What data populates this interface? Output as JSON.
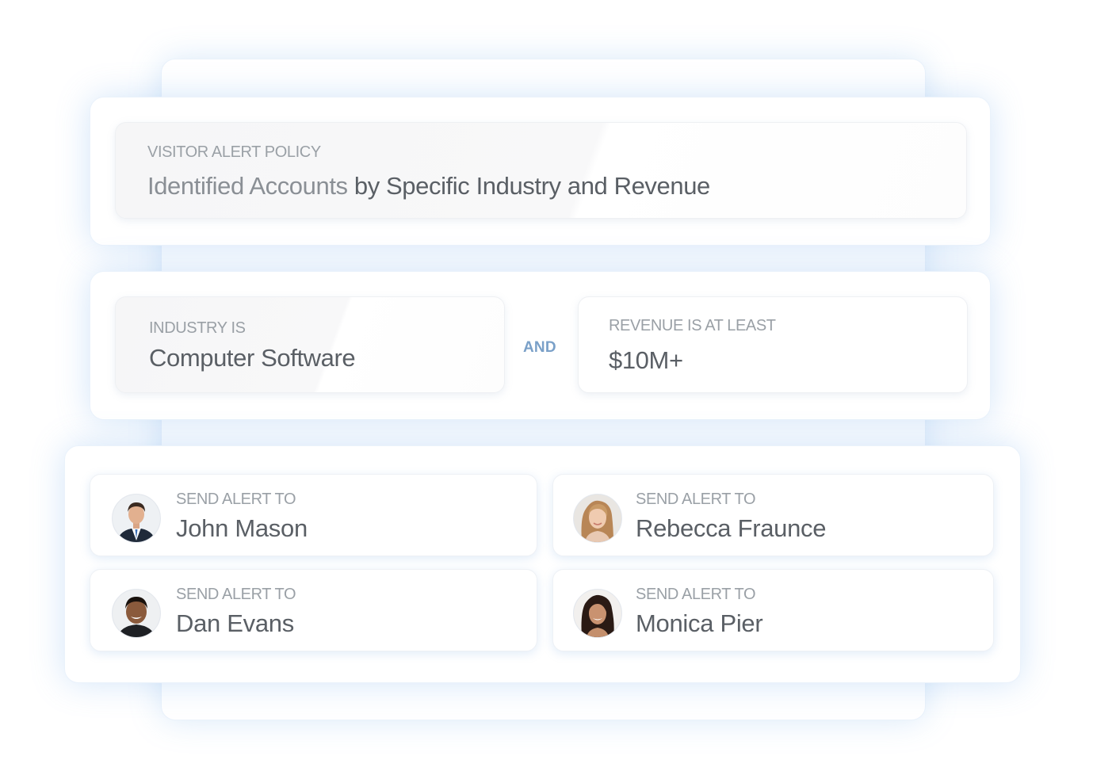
{
  "policy": {
    "label": "VISITOR ALERT POLICY",
    "title_part1": "Identified Accounts",
    "title_part2": "by Specific Industry and Revenue"
  },
  "conditions": {
    "industry": {
      "label": "INDUSTRY IS",
      "value": "Computer Software"
    },
    "connector": "AND",
    "revenue": {
      "label": "REVENUE IS AT LEAST",
      "value": "$10M+"
    }
  },
  "recipients": [
    {
      "label": "SEND ALERT TO",
      "name": "John Mason",
      "avatar_icon": "man-suit-avatar"
    },
    {
      "label": "SEND ALERT TO",
      "name": "Rebecca Fraunce",
      "avatar_icon": "woman-blonde-avatar"
    },
    {
      "label": "SEND ALERT TO",
      "name": "Dan Evans",
      "avatar_icon": "man-smiling-avatar"
    },
    {
      "label": "SEND ALERT TO",
      "name": "Monica Pier",
      "avatar_icon": "woman-dark-hair-avatar"
    }
  ],
  "colors": {
    "glow": "#6eaaeb",
    "connector": "#7aa0c8",
    "label": "#9aa0a6",
    "value": "#5a5f65"
  }
}
